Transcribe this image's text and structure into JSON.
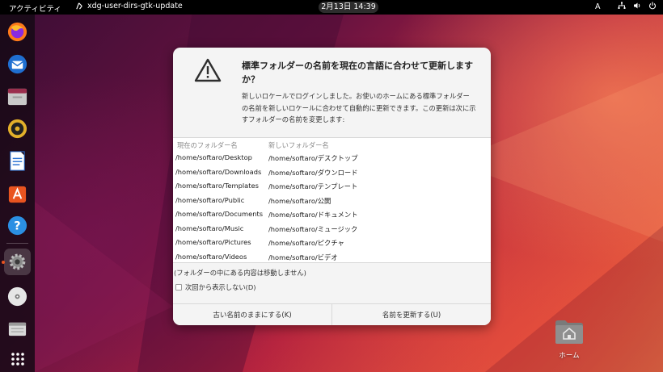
{
  "topbar": {
    "activities": "アクティビティ",
    "app_name": "xdg-user-dirs-gtk-update",
    "clock": "2月13日  14:39",
    "input_indicator": "A"
  },
  "dock": {
    "items": [
      "firefox-icon",
      "thunderbird-icon",
      "files-icon",
      "rhythmbox-icon",
      "writer-icon",
      "software-icon",
      "help-icon",
      "settings-icon",
      "disc-icon",
      "trash-icon",
      "app-grid-icon"
    ]
  },
  "dialog": {
    "title": "標準フォルダーの名前を現在の言語に合わせて更新しますか？",
    "body": "新しいロケールでログインしました。お使いのホームにある標準フォルダーの名前を新しいロケールに合わせて自動的に更新できます。この更新は次に示すフォルダーの名前を変更します:",
    "col_current": "現在のフォルダー名",
    "col_new": "新しいフォルダー名",
    "rows": [
      {
        "current": "/home/softaro/Desktop",
        "new": "/home/softaro/デスクトップ"
      },
      {
        "current": "/home/softaro/Downloads",
        "new": "/home/softaro/ダウンロード"
      },
      {
        "current": "/home/softaro/Templates",
        "new": "/home/softaro/テンプレート"
      },
      {
        "current": "/home/softaro/Public",
        "new": "/home/softaro/公開"
      },
      {
        "current": "/home/softaro/Documents",
        "new": "/home/softaro/ドキュメント"
      },
      {
        "current": "/home/softaro/Music",
        "new": "/home/softaro/ミュージック"
      },
      {
        "current": "/home/softaro/Pictures",
        "new": "/home/softaro/ピクチャ"
      },
      {
        "current": "/home/softaro/Videos",
        "new": "/home/softaro/ビデオ"
      }
    ],
    "note": "(フォルダーの中にある内容は移動しません)",
    "checkbox_label": "次回から表示しない(D)",
    "keep_button": "古い名前のままにする(K)",
    "update_button": "名前を更新する(U)"
  },
  "desktop": {
    "home_label": "ホーム"
  }
}
